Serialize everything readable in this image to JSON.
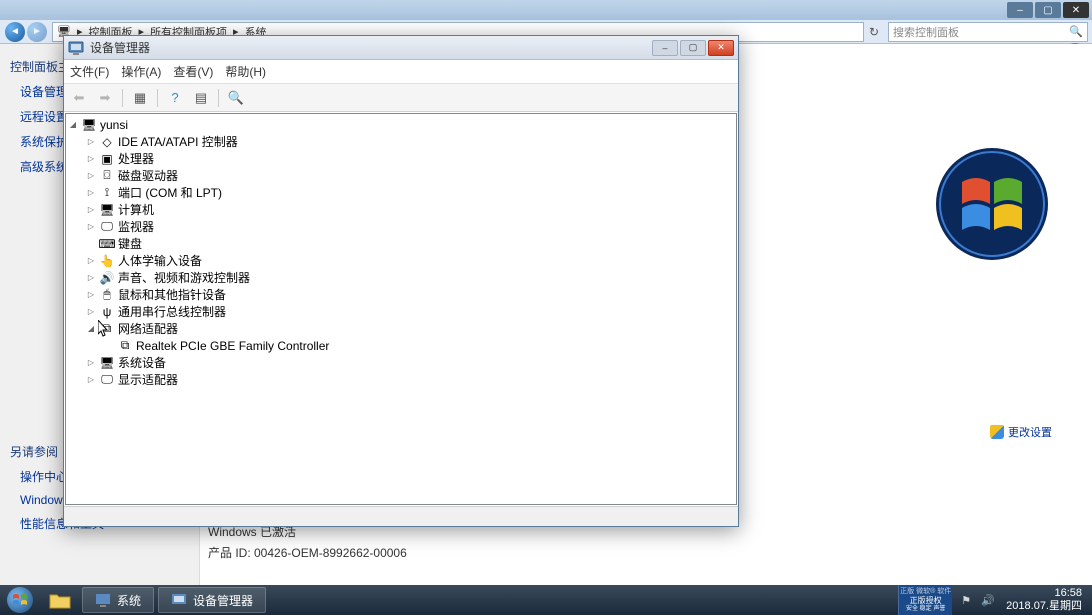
{
  "parent_window": {
    "breadcrumb": {
      "p1": "控制面板",
      "p2": "所有控制面板项",
      "p3": "系统"
    },
    "search_placeholder": "搜索控制面板",
    "sidebar": {
      "title": "控制面板主页",
      "items": [
        "设备管理器",
        "远程设置",
        "系统保护",
        "高级系统设置"
      ],
      "lower_title": "另请参阅",
      "lower_items": [
        "操作中心",
        "Windows Update",
        "性能信息和工具"
      ]
    },
    "change_settings": "更改设置",
    "activation": {
      "line1": "Windows 已激活",
      "line2": "产品 ID: 00426-OEM-8992662-00006"
    }
  },
  "device_manager": {
    "title": "设备管理器",
    "menus": [
      "文件(F)",
      "操作(A)",
      "查看(V)",
      "帮助(H)"
    ],
    "root_name": "yunsi",
    "categories": [
      {
        "label": "IDE ATA/ATAPI 控制器",
        "icon": "◇",
        "has_children": true
      },
      {
        "label": "处理器",
        "icon": "▣",
        "has_children": true
      },
      {
        "label": "磁盘驱动器",
        "icon": "⌼",
        "has_children": true
      },
      {
        "label": "端口 (COM 和 LPT)",
        "icon": "⟟",
        "has_children": true
      },
      {
        "label": "计算机",
        "icon": "🖥",
        "has_children": true
      },
      {
        "label": "监视器",
        "icon": "🖵",
        "has_children": true
      },
      {
        "label": "键盘",
        "icon": "⌨",
        "has_children": false
      },
      {
        "label": "人体学输入设备",
        "icon": "👆",
        "has_children": true
      },
      {
        "label": "声音、视频和游戏控制器",
        "icon": "🔊",
        "has_children": true
      },
      {
        "label": "鼠标和其他指针设备",
        "icon": "🖱",
        "has_children": true
      },
      {
        "label": "通用串行总线控制器",
        "icon": "ψ",
        "has_children": true
      },
      {
        "label": "网络适配器",
        "icon": "⧉",
        "has_children": true,
        "expanded": true,
        "children": [
          {
            "label": "Realtek PCIe GBE Family Controller",
            "icon": "⧉"
          }
        ]
      },
      {
        "label": "系统设备",
        "icon": "🖥",
        "has_children": true
      },
      {
        "label": "显示适配器",
        "icon": "🖵",
        "has_children": true
      }
    ]
  },
  "taskbar": {
    "tasks": [
      "系统",
      "设备管理器"
    ],
    "time": "16:58",
    "date": "2018.07.星期四",
    "genuine": {
      "l1": "正版授权",
      "l2": "安全 稳定 声誉"
    }
  }
}
